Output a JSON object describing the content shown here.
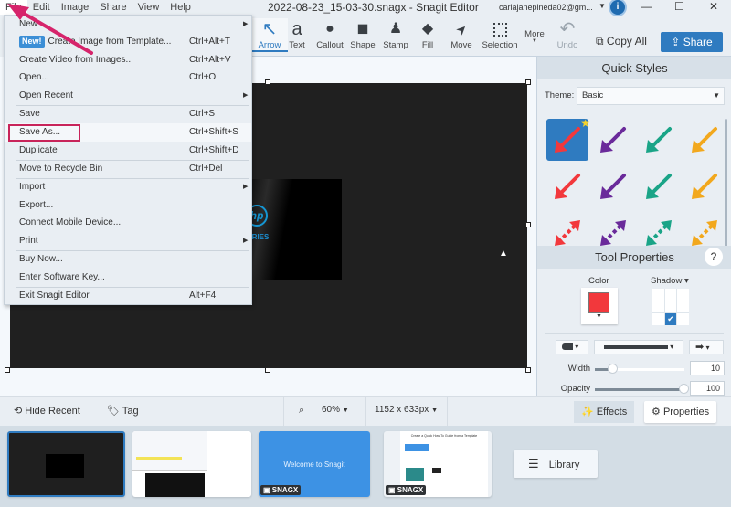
{
  "window": {
    "title": "2022-08-23_15-03-30.snagx - Snagit Editor",
    "account": "carlajanepineda02@gm...",
    "info_badge": "i",
    "minimize": "—",
    "maximize": "☐",
    "close": "✕"
  },
  "menubar": [
    "File",
    "Edit",
    "Image",
    "Share",
    "View",
    "Help"
  ],
  "toolbar": {
    "tools": [
      {
        "label": "Arrow",
        "icon": "arrow-icon",
        "glyph": "↖",
        "selected": true
      },
      {
        "label": "Text",
        "icon": "text-icon",
        "glyph": "a"
      },
      {
        "label": "Callout",
        "icon": "callout-icon",
        "glyph": "💬"
      },
      {
        "label": "Shape",
        "icon": "shape-icon",
        "glyph": "◼"
      },
      {
        "label": "Stamp",
        "icon": "stamp-icon",
        "glyph": "♟"
      },
      {
        "label": "Fill",
        "icon": "fill-icon",
        "glyph": "◆"
      },
      {
        "label": "Move",
        "icon": "move-icon",
        "glyph": "➤"
      },
      {
        "label": "Selection",
        "icon": "selection-icon",
        "glyph": "⬚"
      }
    ],
    "more_label": "More",
    "undo_label": "Undo",
    "copy_all_label": "Copy All",
    "share_label": "Share"
  },
  "file_menu": {
    "items": [
      {
        "label": "New",
        "shortcut": "",
        "submenu": true
      },
      {
        "label": "Create Image from Template...",
        "badge": "New!",
        "shortcut": "Ctrl+Alt+T"
      },
      {
        "label": "Create Video from Images...",
        "shortcut": "Ctrl+Alt+V"
      },
      {
        "label": "Open...",
        "shortcut": "Ctrl+O"
      },
      {
        "label": "Open Recent",
        "shortcut": "",
        "submenu": true
      },
      {
        "label": "Save",
        "shortcut": "Ctrl+S"
      },
      {
        "label": "Save As...",
        "shortcut": "Ctrl+Shift+S",
        "highlighted": true
      },
      {
        "label": "Duplicate",
        "shortcut": "Ctrl+Shift+D"
      },
      {
        "label": "Move to Recycle Bin",
        "shortcut": "Ctrl+Del"
      },
      {
        "label": "Import",
        "shortcut": "",
        "submenu": true
      },
      {
        "label": "Export...",
        "shortcut": ""
      },
      {
        "label": "Connect Mobile Device...",
        "shortcut": ""
      },
      {
        "label": "Print",
        "shortcut": "",
        "submenu": true
      },
      {
        "label": "Buy Now...",
        "shortcut": ""
      },
      {
        "label": "Enter Software Key...",
        "shortcut": ""
      },
      {
        "label": "Exit Snagit Editor",
        "shortcut": "Alt+F4"
      }
    ]
  },
  "canvas": {
    "image_text": "SERIES",
    "logo": "hp"
  },
  "quick_styles": {
    "title": "Quick Styles",
    "theme_label": "Theme:",
    "theme_value": "Basic",
    "colors": [
      "#f2383c",
      "#6a2a9a",
      "#1aa487",
      "#f2a81d"
    ]
  },
  "tool_properties": {
    "title": "Tool Properties",
    "help": "?",
    "color_label": "Color",
    "color_value": "#f2383c",
    "shadow_label": "Shadow ▾",
    "width_label": "Width",
    "width_value": "10",
    "width_fraction": 0.2,
    "opacity_label": "Opacity",
    "opacity_value": "100",
    "opacity_fraction": 1.0
  },
  "statusbar": {
    "hide_recent": "Hide Recent",
    "tag": "Tag",
    "zoom": "60%",
    "dimensions": "1152 x 633px",
    "effects": "Effects",
    "properties": "Properties"
  },
  "tray": {
    "welcome_text": "Welcome to Snagit",
    "snagx_badge": "SNAGX",
    "template_title": "Create a Quick How-To Guide from a Template",
    "library_label": "Library"
  }
}
